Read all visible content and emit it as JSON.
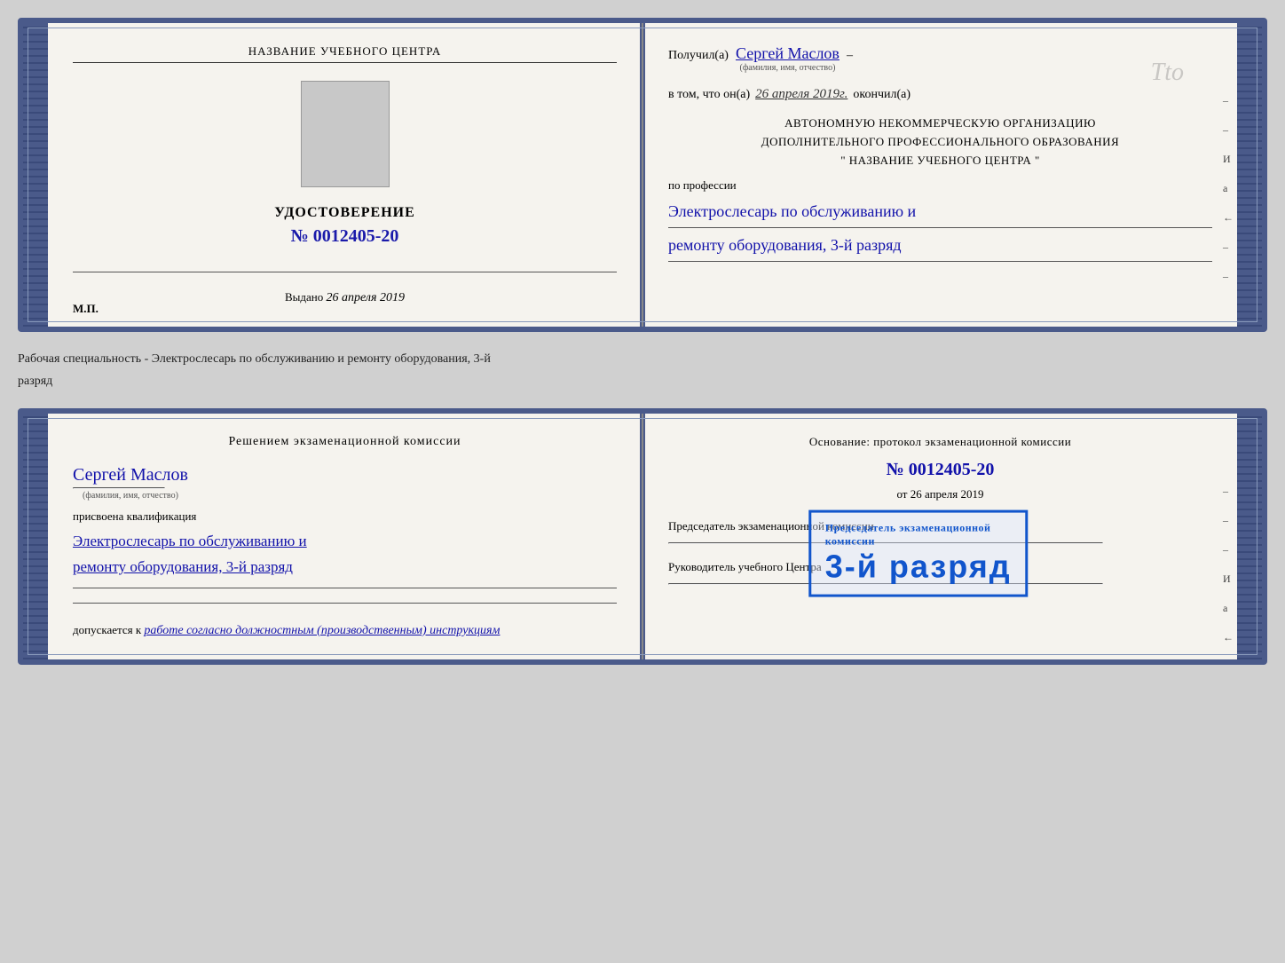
{
  "topCert": {
    "leftPage": {
      "schoolName": "НАЗВАНИЕ УЧЕБНОГО ЦЕНТРА",
      "photoAlt": "Фото",
      "udostoverenie": "УДОСТОВЕРЕНИЕ",
      "number": "№ 0012405-20",
      "vydanoLabel": "Выдано",
      "vydanoDate": "26 апреля 2019",
      "mpLabel": "М.П."
    },
    "rightPage": {
      "poluchilLabel": "Получил(а)",
      "recipientName": "Сергей Маслов",
      "fioLabel": "(фамилия, имя, отчество)",
      "vtomChtoLabel": "в том, что он(а)",
      "completionDate": "26 апреля 2019г.",
      "okonchilLabel": "окончил(а)",
      "orgLine1": "АВТОНОМНУЮ НЕКОММЕРЧЕСКУЮ ОРГАНИЗАЦИЮ",
      "orgLine2": "ДОПОЛНИТЕЛЬНОГО ПРОФЕССИОНАЛЬНОГО ОБРАЗОВАНИЯ",
      "orgLine3": "\"   НАЗВАНИЕ УЧЕБНОГО ЦЕНТРА   \"",
      "poProfessiiLabel": "по профессии",
      "profession1": "Электрослесарь по обслуживанию и",
      "profession2": "ремонту оборудования, 3-й разряд"
    }
  },
  "betweenLabel": {
    "line1": "Рабочая специальность - Электрослесарь по обслуживанию и ремонту оборудования, 3-й",
    "line2": "разряд"
  },
  "bottomCert": {
    "leftPage": {
      "resheniemTitle": "Решением  экзаменационной  комиссии",
      "personName": "Сергей Маслов",
      "fioLabel": "(фамилия, имя, отчество)",
      "prisvoenaLabel": "присвоена квалификация",
      "qual1": "Электрослесарь по обслуживанию и",
      "qual2": "ремонту оборудования, 3-й разряд",
      "dopuskaetsyaLabel": "допускается к",
      "dopuskaetsyaValue": "работе согласно должностным (производственным) инструкциям"
    },
    "rightPage": {
      "osnovanieTitleLine1": "Основание: протокол экзаменационной  комиссии",
      "protocolNumber": "№  0012405-20",
      "otLabel": "от",
      "otDate": "26 апреля 2019",
      "predsedatelLabel": "Председатель экзаменационной комиссии",
      "rukovoditelLabel": "Руководитель учебного Центра"
    },
    "stamp": {
      "topText": "Председатель экзаменационной",
      "topText2": "комиссии",
      "bigText": "3-й разряд"
    }
  },
  "marginNotes": [
    "И",
    "а",
    "←",
    "–",
    "–",
    "–",
    "–"
  ]
}
